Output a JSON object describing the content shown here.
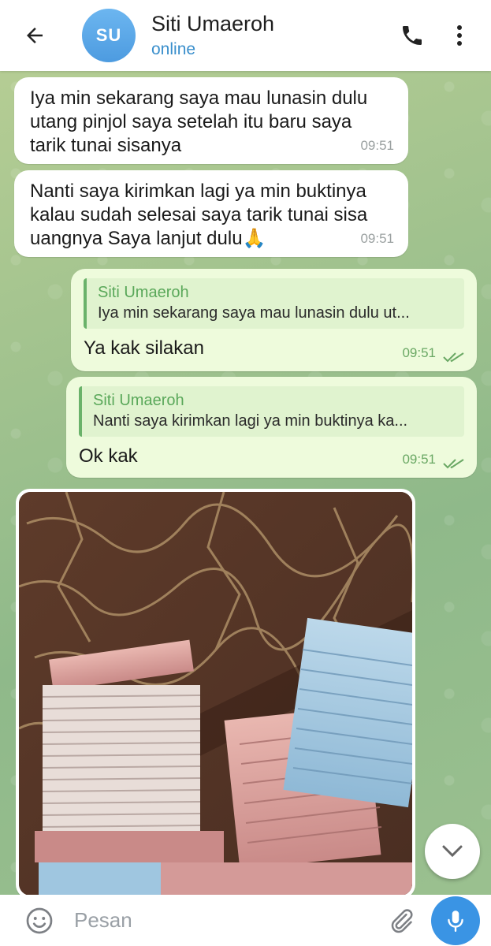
{
  "header": {
    "avatar_initials": "SU",
    "avatar_color": "#5aa6e8",
    "contact_name": "Siti Umaeroh",
    "status": "online",
    "icons": [
      "back-arrow-icon",
      "phone-icon",
      "more-vertical-icon"
    ]
  },
  "messages": [
    {
      "direction": "incoming",
      "text_lines": [
        "Iya min sekarang saya mau lunasin dulu",
        "utang pinjol saya setelah itu baru saya",
        "tarik tunai sisanya"
      ],
      "time": "09:51"
    },
    {
      "direction": "incoming",
      "text_lines": [
        "Nanti saya kirimkan lagi ya min buktinya",
        "kalau sudah selesai saya tarik tunai sisa",
        "uangnya Saya lanjut dulu🙏"
      ],
      "time": "09:51"
    },
    {
      "direction": "outgoing",
      "reply_to_name": "Siti Umaeroh",
      "reply_to_text": "Iya min sekarang saya mau lunasin dulu ut...",
      "text": "Ya kak silakan",
      "time": "09:51",
      "read": true
    },
    {
      "direction": "outgoing",
      "reply_to_name": "Siti Umaeroh",
      "reply_to_text": "Nanti saya kirimkan lagi ya min buktinya ka...",
      "text": "Ok kak",
      "time": "09:51",
      "read": true
    },
    {
      "direction": "incoming",
      "type": "photo",
      "photo_subject": "stacks of banknotes on a marble surface"
    }
  ],
  "input": {
    "placeholder": "Pesan",
    "icons": [
      "emoji-icon",
      "attach-icon",
      "mic-icon"
    ]
  },
  "colors": {
    "outgoing_bubble": "#eefbdc",
    "incoming_bubble": "#ffffff",
    "accent": "#3a94e4",
    "check_green": "#6aa864"
  }
}
